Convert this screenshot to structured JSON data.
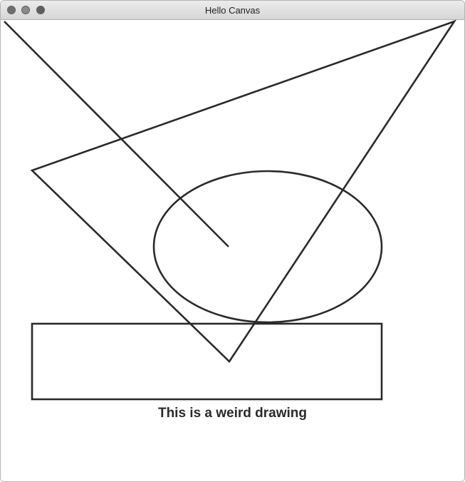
{
  "window": {
    "title": "Hello Canvas"
  },
  "canvas": {
    "caption": "This is a weird drawing",
    "stroke_color": "#2a2a2a"
  }
}
